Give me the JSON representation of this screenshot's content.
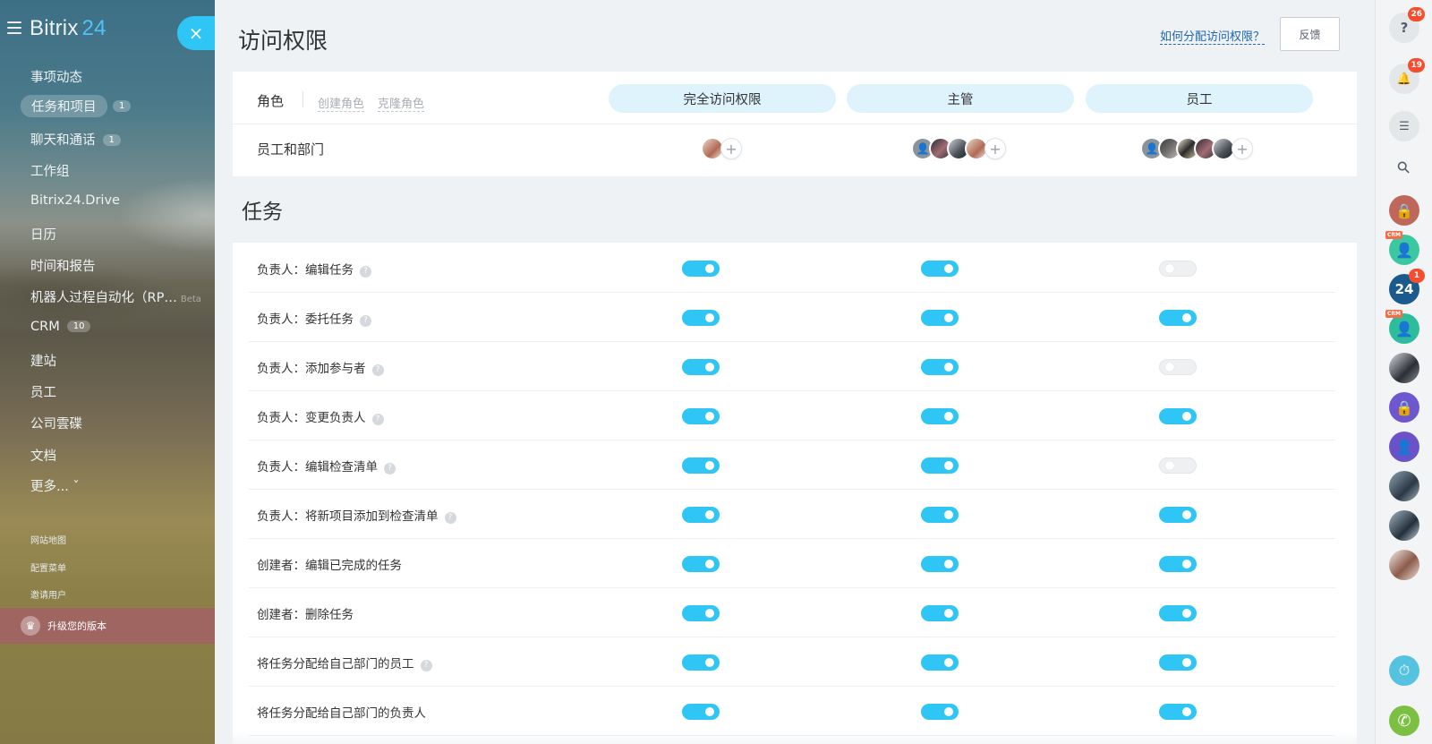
{
  "sidebar": {
    "logo_text": "Bitrix",
    "logo_num": "24",
    "close_icon": "×",
    "items": [
      {
        "label": "事项动态"
      },
      {
        "label": "任务和项目",
        "badge": "1"
      },
      {
        "label": "聊天和通话",
        "badge": "1"
      },
      {
        "label": "工作组"
      },
      {
        "label": "Bitrix24.Drive"
      },
      {
        "label": "日历"
      },
      {
        "label": "时间和报告"
      },
      {
        "label": "机器人过程自动化（RP…",
        "beta": "Beta"
      },
      {
        "label": "CRM",
        "badge": "10"
      },
      {
        "label": "建站"
      },
      {
        "label": "员工"
      },
      {
        "label": "公司雲碟"
      },
      {
        "label": "文档"
      },
      {
        "label": "更多... ˇ"
      }
    ],
    "small_links": [
      "网站地图",
      "配置菜单",
      "邀请用户"
    ],
    "upgrade_label": "升级您的版本",
    "upgrade_icon": "♛"
  },
  "header": {
    "title": "访问权限",
    "help_link": "如何分配访问权限？",
    "feedback_button": "反馈"
  },
  "roles": {
    "label": "角色",
    "create_role": "创建角色",
    "clone_role": "克隆角色",
    "columns": [
      "完全访问权限",
      "主管",
      "员工"
    ],
    "employees_label": "员工和部门",
    "add_icon": "+"
  },
  "section_title": "任务",
  "permissions": [
    {
      "label": "负责人：编辑任务",
      "help": true,
      "values": [
        true,
        true,
        false
      ]
    },
    {
      "label": "负责人：委托任务",
      "help": true,
      "values": [
        true,
        true,
        true
      ]
    },
    {
      "label": "负责人：添加参与者",
      "help": true,
      "values": [
        true,
        true,
        false
      ]
    },
    {
      "label": "负责人：变更负责人",
      "help": true,
      "values": [
        true,
        true,
        true
      ]
    },
    {
      "label": "负责人：编辑检查清单",
      "help": true,
      "values": [
        true,
        true,
        false
      ]
    },
    {
      "label": "负责人：将新项目添加到检查清单",
      "help": true,
      "values": [
        true,
        true,
        true
      ]
    },
    {
      "label": "创建者：编辑已完成的任务",
      "help": false,
      "values": [
        true,
        true,
        true
      ]
    },
    {
      "label": "创建者：删除任务",
      "help": false,
      "values": [
        true,
        true,
        true
      ]
    },
    {
      "label": "将任务分配给自己部门的员工",
      "help": true,
      "values": [
        true,
        true,
        true
      ]
    },
    {
      "label": "将任务分配给自己部门的负责人",
      "help": false,
      "values": [
        true,
        true,
        true
      ]
    }
  ],
  "help_icon": "?",
  "right_panel": {
    "help_badge": "26",
    "notifications_badge": "19",
    "b24_badge": "1",
    "b24_label": "24",
    "crm_tag": "CRM",
    "help_icon": "?",
    "bell_icon": "🔔",
    "chat_icon": "☰",
    "search_icon": "⚲",
    "lock_icon": "🔒",
    "user_icon": "👤",
    "phone_icon": "✆",
    "timeman_icon": "⏱"
  },
  "colors": {
    "accent": "#2fc6f6",
    "role_pill": "#dff3fc",
    "badge_red": "#f54d2e",
    "link": "#2067b0"
  }
}
